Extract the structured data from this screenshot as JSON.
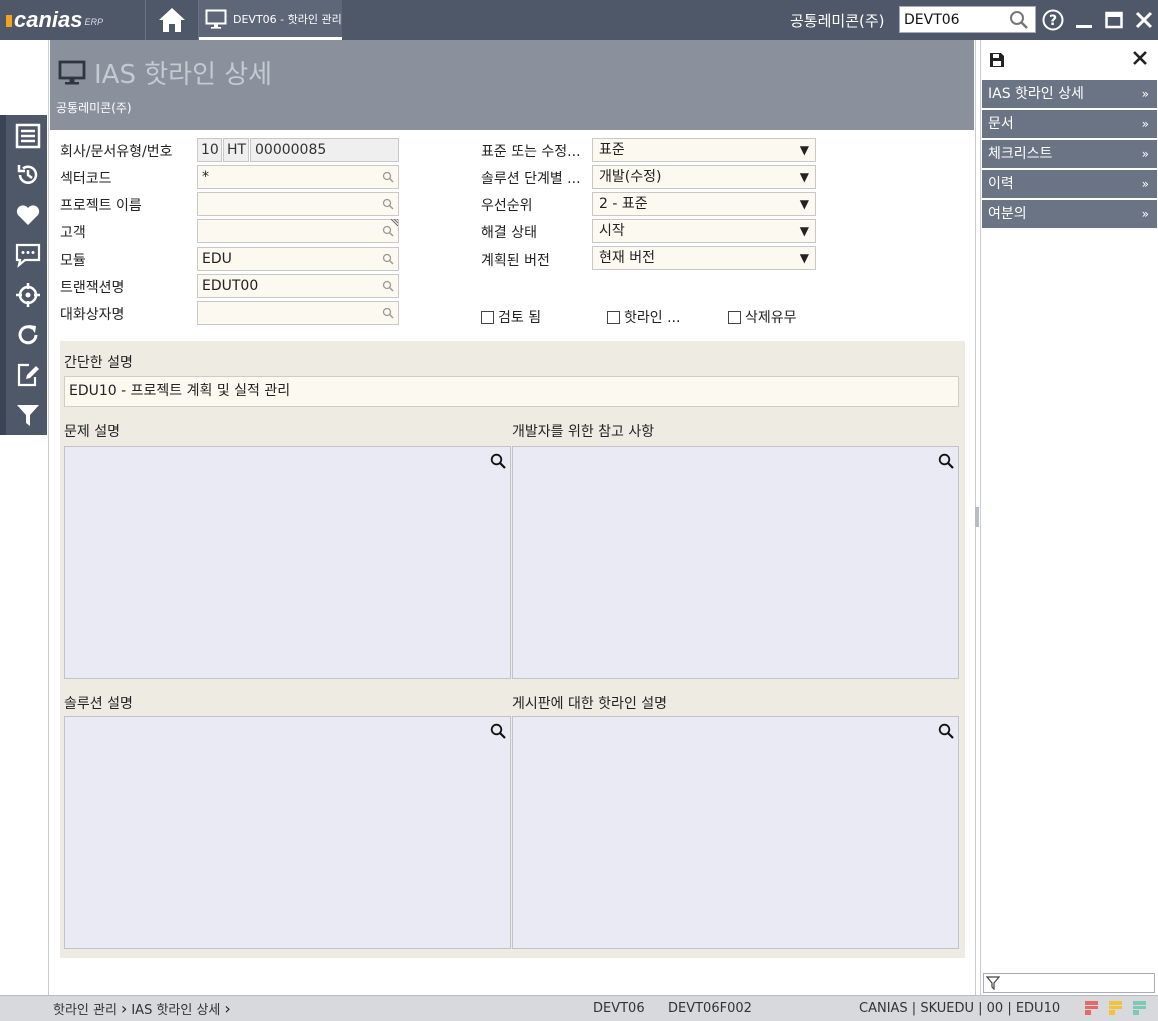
{
  "app": {
    "logo": "canias",
    "logo_sup": "ERP",
    "tab_label": "DEVT06 - 핫라인 관리",
    "company": "공통레미콘(주)",
    "search_value": "DEVT06"
  },
  "page": {
    "title": "IAS 핫라인 상세",
    "subtitle": "공통레미콘(주)"
  },
  "form": {
    "left": [
      {
        "label": "회사/문서유형/번호"
      },
      {
        "label": "섹터코드",
        "value": "*"
      },
      {
        "label": "프로젝트 이름",
        "value": ""
      },
      {
        "label": "고객",
        "value": ""
      },
      {
        "label": "모듈",
        "value": "EDU"
      },
      {
        "label": "트랜잭션명",
        "value": "EDUT00"
      },
      {
        "label": "대화상자명",
        "value": ""
      }
    ],
    "doc": {
      "company": "10",
      "type": "HT",
      "number": "00000085"
    },
    "right": [
      {
        "label": "표준 또는 수정...",
        "value": "표준"
      },
      {
        "label": "솔루션 단계별 ...",
        "value": "개발(수정)"
      },
      {
        "label": "우선순위",
        "value": "2 - 표준"
      },
      {
        "label": "해결 상태",
        "value": "시작"
      },
      {
        "label": "계획된 버전",
        "value": "현재 버전"
      }
    ],
    "checkboxes": [
      {
        "label": "검토 됨",
        "checked": false
      },
      {
        "label": "핫라인 ...",
        "checked": false
      },
      {
        "label": "삭제유무",
        "checked": false
      }
    ]
  },
  "descriptions": {
    "short_label": "간단한 설명",
    "short_value": "EDU10 - 프로젝트 계획 및 실적 관리",
    "problem_label": "문제 설명",
    "dev_note_label": "개발자를 위한 참고 사항",
    "solution_label": "솔루션 설명",
    "board_label": "게시판에 대한 핫라인 설명"
  },
  "right_panel": {
    "items": [
      "IAS 핫라인 상세",
      "문서",
      "체크리스트",
      "이력",
      "여분의"
    ]
  },
  "status": {
    "breadcrumb": [
      "핫라인 관리",
      "IAS 핫라인 상세"
    ],
    "client": "DEVT06",
    "session": "DEVT06F002",
    "info": "CANIAS | SKUEDU | 00 | EDU10"
  }
}
